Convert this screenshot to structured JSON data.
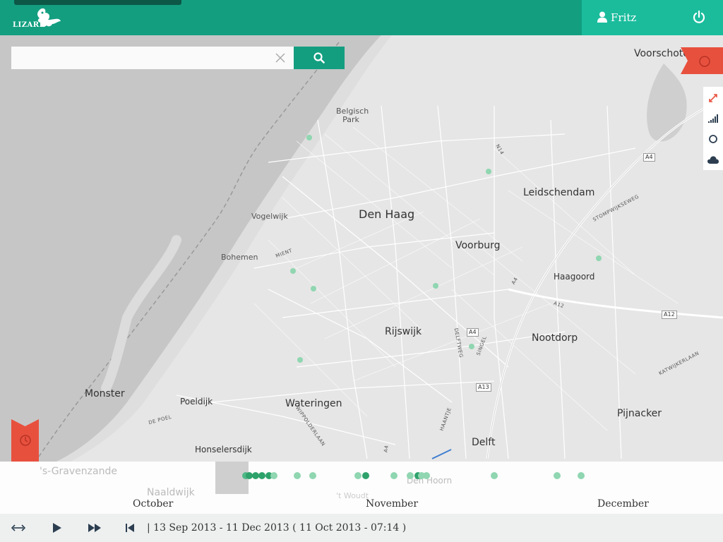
{
  "header": {
    "logo_text": "LIZARD",
    "user_name": "Fritz",
    "colors": {
      "header": "#139e80",
      "user_panel": "#1abc9c",
      "accent_red": "#e8503e"
    }
  },
  "search": {
    "placeholder": "",
    "value": ""
  },
  "map_labels": {
    "den_haag": "Den Haag",
    "voorburg": "Voorburg",
    "leidschendam": "Leidschendam",
    "rijswijk": "Rijswijk",
    "nootdorp": "Nootdorp",
    "delft": "Delft",
    "wateringen": "Wateringen",
    "monster": "Monster",
    "pijnacker": "Pijnacker",
    "voorschoten": "Voorschote",
    "poeldijk": "Poeldijk",
    "honselersdijk": "Honselersdijk",
    "haagoord": "Haagoord",
    "bohemen": "Bohemen",
    "vogelwijk": "Vogelwijk",
    "belgisch_park": "Belgisch Park",
    "gravenzande": "'s-Gravenzande",
    "naaldwijk": "Naaldwijk",
    "den_hoorn": "Den Hoorn",
    "t_woudt": "'t Woudt",
    "mient": "MIENT",
    "wippolderlaan": "WIPPOLDERLAAN",
    "de_poel": "DE POEL",
    "haantje": "HAANTJE",
    "singel": "SINGEL",
    "delftweg": "DELFTWEG",
    "stompwijkseweg": "STOMPWIJKSEWEG",
    "katwijkerlaan": "KATWIJKERLAAN",
    "n14": "N14",
    "a4_top": "A4",
    "a4_mid": "A4",
    "a12": "A12",
    "a12_b": "A12",
    "a13": "A13",
    "a4_low": "A4",
    "a4_road": "A4",
    "s_cut": "S"
  },
  "tools": {
    "fullscreen_icon": "expand-icon",
    "signal_icon": "signal-bars-icon",
    "circle_icon": "circle-icon",
    "cloud_icon": "cloud-icon"
  },
  "timeline": {
    "months": [
      "October",
      "November",
      "December"
    ],
    "range_text": "| 13 Sep 2013 - 11 Dec 2013 ( 11 Oct 2013 - 07:14 )"
  }
}
